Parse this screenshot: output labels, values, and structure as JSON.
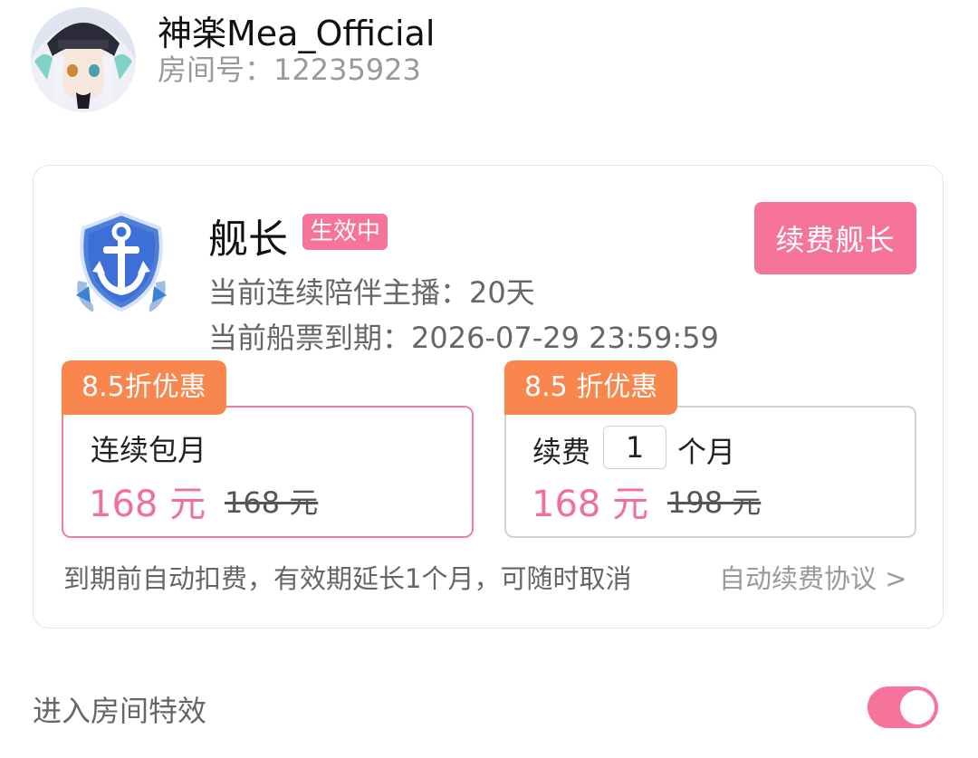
{
  "streamer": {
    "name": "神楽Mea_Official",
    "room_label": "房间号：12235923"
  },
  "membership": {
    "tier_name": "舰长",
    "status_tag": "生效中",
    "renew_button": "续费舰长",
    "days_line": "当前连续陪伴主播：20天",
    "expiry_line": "当前船票到期：2026-07-29 23:59:59",
    "badge_icon": "anchor-badge-icon"
  },
  "plans": [
    {
      "discount_tag": "8.5折优惠",
      "title": "连续包月",
      "price": "168 元",
      "original_price": "168 元",
      "selected": true
    },
    {
      "discount_tag": "8.5 折优惠",
      "title_prefix": "续费",
      "quantity": "1",
      "title_suffix": "个月",
      "price": "168 元",
      "original_price": "198 元",
      "selected": false
    }
  ],
  "auto_renew_note": "到期前自动扣费，有效期延长1个月，可随时取消",
  "agreement_link": "自动续费协议 >",
  "room_effect": {
    "label": "进入房间特效",
    "enabled": true
  },
  "colors": {
    "accent_pink": "#f6749b",
    "discount_orange": "#f8864d",
    "price_pink": "#f07098",
    "badge_blue": "#3d6fd6"
  }
}
